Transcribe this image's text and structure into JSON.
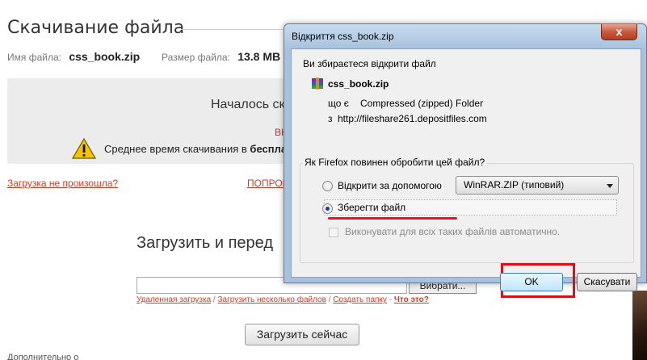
{
  "page": {
    "title": "Скачивание файла",
    "file_name_label": "Имя файла:",
    "file_name_value": "css_book.zip",
    "file_size_label": "Размер файла:",
    "file_size_value": "13.8 МВ",
    "download_started": "Началось ск",
    "red_fragment": "ВН",
    "avg_time_text": "Среднее время скачивания в",
    "avg_time_bold": "бесплат",
    "link_not_started": "Загрузка не произошла?",
    "link_try": "ПОПРОЕ",
    "upload_heading": "Загрузить и перед",
    "browse_label": "Вибрати...",
    "link_remote": "Удаленная загрузка",
    "link_multiple": "Загрузить несколько файлов",
    "link_create_folder": "Создать папку",
    "link_what": "Что это?",
    "upload_now": "Загрузить сейчас",
    "bottom_text": "Дополнительно о"
  },
  "dialog": {
    "title": "Відкриття css_book.zip",
    "close_glyph": "x",
    "question": "Ви збираєтеся відкрити файл",
    "file_name": "css_book.zip",
    "type_label": "що є",
    "type_value": "Compressed (zipped) Folder",
    "from_label": "з",
    "from_value": "http://fileshare261.depositfiles.com",
    "group_legend": "Як Firefox повинен обробити цей файл?",
    "open_with_label": "Відкрити за допомогою",
    "open_with_app": "WinRAR.ZIP (типовий)",
    "save_file_label": "Зберегти файл",
    "auto_label": "Виконувати для всіх таких файлів автоматично.",
    "ok_label": "OK",
    "cancel_label": "Скасувати",
    "selected_option": "save",
    "highlight_color": "#d9101c"
  }
}
